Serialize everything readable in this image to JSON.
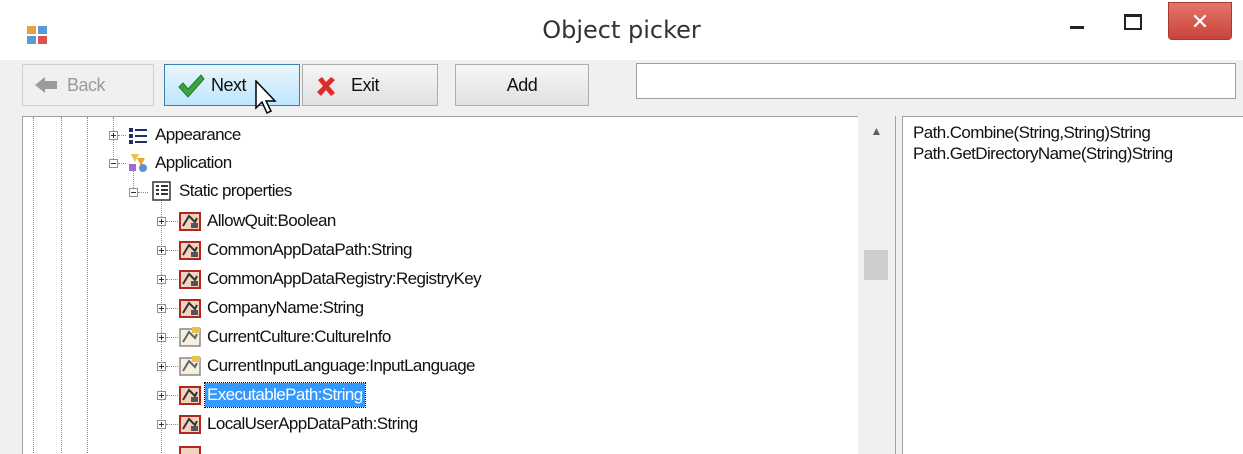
{
  "window": {
    "title": "Object picker"
  },
  "toolbar": {
    "back_label": "Back",
    "next_label": "Next",
    "exit_label": "Exit",
    "add_label": "Add",
    "search_value": ""
  },
  "tree": {
    "nodes": [
      {
        "label": "Appearance",
        "icon": "list-icon",
        "expander": "plus"
      },
      {
        "label": "Application",
        "icon": "application-icon",
        "expander": "minus"
      },
      {
        "label": "Static properties",
        "icon": "properties-icon",
        "expander": "minus"
      },
      {
        "label": "AllowQuit:Boolean",
        "icon": "property-icon",
        "expander": "plus"
      },
      {
        "label": "CommonAppDataPath:String",
        "icon": "property-icon",
        "expander": "plus"
      },
      {
        "label": "CommonAppDataRegistry:RegistryKey",
        "icon": "property-icon",
        "expander": "plus"
      },
      {
        "label": "CompanyName:String",
        "icon": "property-icon",
        "expander": "plus"
      },
      {
        "label": "CurrentCulture:CultureInfo",
        "icon": "property-readwrite-icon",
        "expander": "plus"
      },
      {
        "label": "CurrentInputLanguage:InputLanguage",
        "icon": "property-readwrite-icon",
        "expander": "plus"
      },
      {
        "label": "ExecutablePath:String",
        "icon": "property-icon",
        "expander": "plus",
        "selected": true
      },
      {
        "label": "LocalUserAppDataPath:String",
        "icon": "property-icon",
        "expander": "plus"
      }
    ]
  },
  "methods": [
    "Path.Combine(String,String)String",
    "Path.GetDirectoryName(String)String"
  ],
  "colors": {
    "selection": "#3399ff",
    "close_button": "#c8433a",
    "next_button_border": "#3c7fb1"
  }
}
